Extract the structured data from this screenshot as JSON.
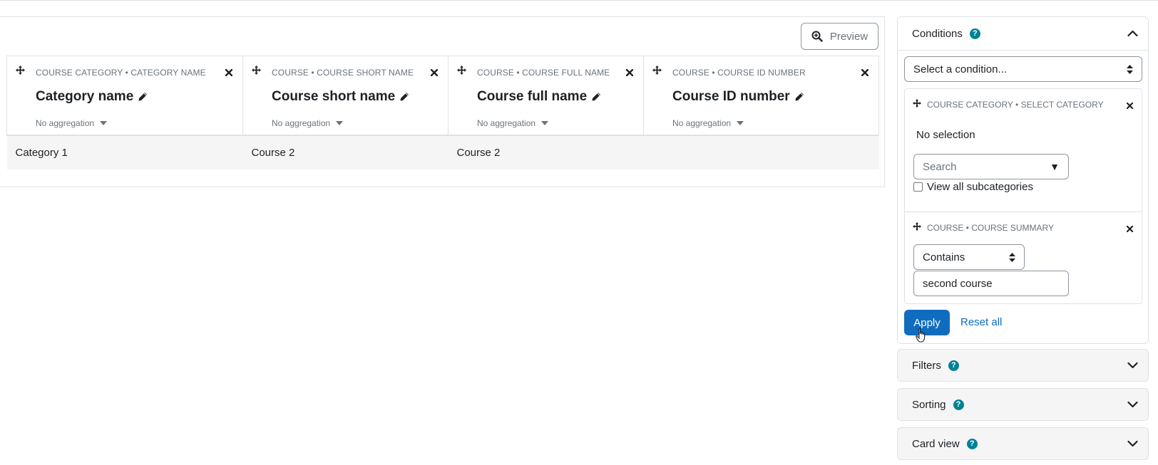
{
  "toolbar": {
    "preview_label": "Preview"
  },
  "columns": [
    {
      "path": "COURSE CATEGORY • CATEGORY NAME",
      "title": "Category name",
      "aggregation": "No aggregation"
    },
    {
      "path": "COURSE • COURSE SHORT NAME",
      "title": "Course short name",
      "aggregation": "No aggregation"
    },
    {
      "path": "COURSE • COURSE FULL NAME",
      "title": "Course full name",
      "aggregation": "No aggregation"
    },
    {
      "path": "COURSE • COURSE ID NUMBER",
      "title": "Course ID number",
      "aggregation": "No aggregation"
    }
  ],
  "rows": [
    [
      "Category 1",
      "Course 2",
      "Course 2",
      ""
    ]
  ],
  "sidebar": {
    "conditions": {
      "title": "Conditions",
      "select_placeholder": "Select a condition...",
      "items": [
        {
          "path": "COURSE CATEGORY • SELECT CATEGORY",
          "selection": "No selection",
          "search_placeholder": "Search",
          "checkbox_label": "View all subcategories"
        },
        {
          "path": "COURSE • COURSE SUMMARY",
          "operator": "Contains",
          "value": "second course"
        }
      ],
      "apply_label": "Apply",
      "reset_label": "Reset all"
    },
    "filters": {
      "title": "Filters"
    },
    "sorting": {
      "title": "Sorting"
    },
    "cardview": {
      "title": "Card view"
    }
  },
  "colors": {
    "primary": "#0f6cbf",
    "help": "#008196",
    "border": "#dee2e6",
    "muted": "#6a737b"
  }
}
